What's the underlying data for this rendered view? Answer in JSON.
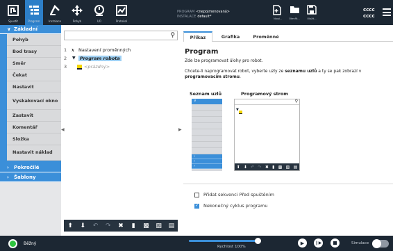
{
  "topbar": {
    "nav": [
      {
        "label": "Spustit",
        "icon": "robot-arm-run-icon"
      },
      {
        "label": "Program",
        "icon": "program-list-icon"
      },
      {
        "label": "Instalace",
        "icon": "installation-icon"
      },
      {
        "label": "Pohyb",
        "icon": "move-arrows-icon"
      },
      {
        "label": "I/O",
        "icon": "io-icon"
      },
      {
        "label": "Protokol",
        "icon": "log-chart-icon"
      }
    ],
    "program_key": "PROGRAM",
    "program_value": "<nepojmenovaná>",
    "installation_key": "INSTALACE",
    "installation_value": "default*",
    "file_buttons": [
      {
        "label": "Nový...",
        "icon": "new-file-icon"
      },
      {
        "label": "Otevřít...",
        "icon": "open-folder-icon"
      },
      {
        "label": "Uložit...",
        "icon": "save-icon"
      }
    ],
    "user_line1": "cccc",
    "user_line2": "cccc"
  },
  "sidebar": {
    "basic_header": "Základní",
    "basic_items": [
      "Pohyb",
      "Bod trasy",
      "Směr",
      "Čekat",
      "Nastavit",
      "Vyskakovací okno",
      "Zastavit",
      "Komentář",
      "Složka",
      "Nastavit náklad"
    ],
    "advanced_header": "Pokročilé",
    "templates_header": "Šablony"
  },
  "tree": {
    "search_placeholder": "",
    "rows": [
      {
        "num": "1",
        "text": "Nastavení proměnných",
        "icon": "variables-x-icon"
      },
      {
        "num": "2",
        "text": "Program robota",
        "icon": "program-triangle-icon"
      },
      {
        "num": "3",
        "text": "<prázdný>",
        "icon": "empty-node-icon"
      }
    ],
    "toolbar": [
      "move-up-icon",
      "move-down-icon",
      "undo-icon",
      "redo-icon",
      "cut-icon",
      "copy-icon",
      "paste-icon",
      "delete-icon",
      "suppress-icon"
    ]
  },
  "tabs": [
    "Příkaz",
    "Grafika",
    "Proměnné"
  ],
  "content": {
    "title": "Program",
    "subtitle": "Zde lze programovat úlohy pro robot.",
    "desc_part1": "Chcete-li naprogramovat robot, vyberte uzly ze ",
    "desc_bold1": "seznamu uzlů",
    "desc_part2": " a ty se pak zobrazí v ",
    "desc_bold2": "programovacím stromu",
    "desc_end": ".",
    "node_list_label": "Seznam uzlů",
    "program_tree_label": "Programový strom",
    "checkbox1_label": "Přidat sekvenci Před spuštěním",
    "checkbox1_checked": false,
    "checkbox2_label": "Nekonečný cyklus programu",
    "checkbox2_checked": true
  },
  "footer": {
    "status": "Běžný",
    "speed_label": "Rychlost 100%",
    "speed_value": 1.0,
    "simulation_label": "Simulace",
    "simulation_on": false
  },
  "colors": {
    "topbar": "#1c2733",
    "accent": "#3b8fd9",
    "power_green": "#2ec43e"
  }
}
